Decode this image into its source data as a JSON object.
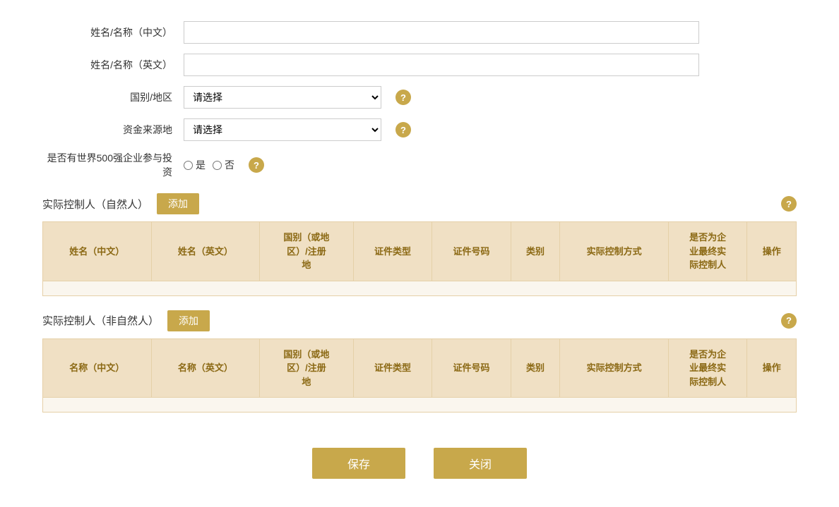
{
  "form": {
    "name_cn_label": "姓名/名称（中文）",
    "name_en_label": "姓名/名称（英文）",
    "country_label": "国别/地区",
    "fund_source_label": "资金来源地",
    "fortune500_label": "是否有世界500强企业参与投资",
    "country_placeholder": "请选择",
    "fund_source_placeholder": "请选择",
    "radio_yes": "是",
    "radio_no": "否"
  },
  "natural_person_section": {
    "title": "实际控制人（自然人）",
    "add_btn": "添加",
    "columns": [
      "姓名（中文）",
      "姓名（英文）",
      "国别（或地\n区）/注册\n地",
      "证件类型",
      "证件号码",
      "类别",
      "实际控制方式",
      "是否为企\n业最终实\n际控制人",
      "操作"
    ]
  },
  "non_natural_person_section": {
    "title": "实际控制人（非自然人）",
    "add_btn": "添加",
    "columns": [
      "名称（中文）",
      "名称（英文）",
      "国别（或地\n区）/注册\n地",
      "证件类型",
      "证件号码",
      "类别",
      "实际控制方式",
      "是否为企\n业最终实\n际控制人",
      "操作"
    ]
  },
  "actions": {
    "save": "保存",
    "close": "关闭"
  },
  "colors": {
    "gold": "#c8a84b",
    "table_header_bg": "#f0e0c4",
    "table_bg": "#faf6ee",
    "header_text": "#8b6914"
  }
}
